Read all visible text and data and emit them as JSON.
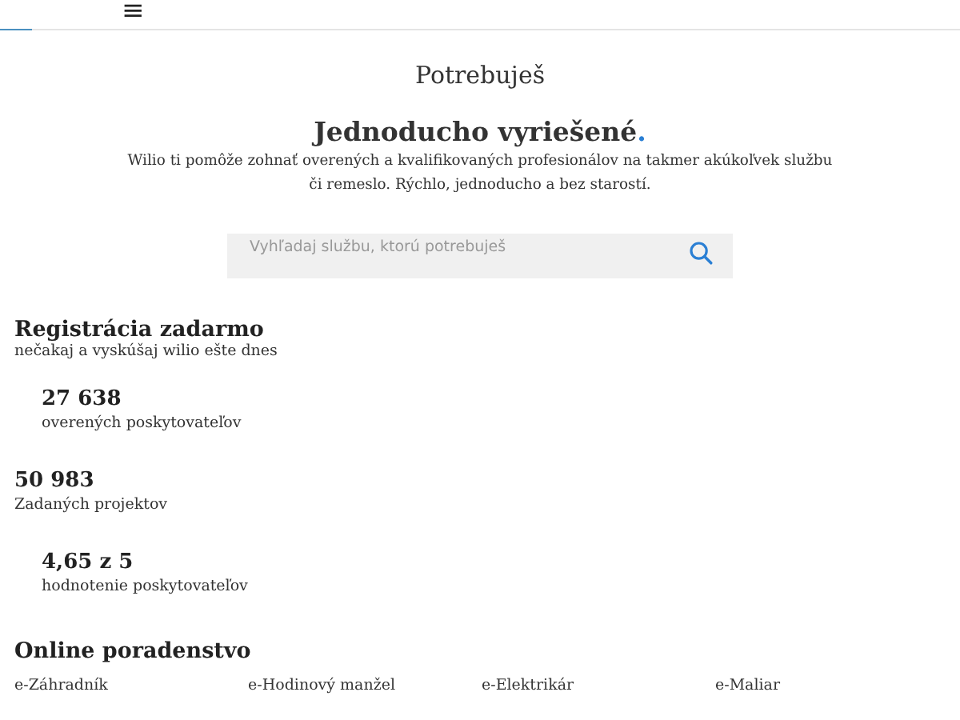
{
  "header": {
    "menu": "≡"
  },
  "hero": {
    "kicker": "Potrebuješ",
    "title": "Jednoducho vyriešené",
    "title_accent": ".",
    "text": "Wilio ti pomôže zohnať overených a kvalifikovaných profesionálov na takmer akúkoľvek službu či remeslo. Rýchlo, jednoducho a bez starostí."
  },
  "search": {
    "placeholder": "Vyhľadaj službu, ktorú potrebuješ"
  },
  "registration": {
    "title": "Registrácia zadarmo",
    "subtitle": "nečakaj a vyskúšaj wilio ešte dnes"
  },
  "stats": [
    {
      "kind": "indented",
      "value": "27 638",
      "label": "overených poskytovateľov"
    },
    {
      "kind": "plain",
      "value": "50 983",
      "label": "Zadaných projektov"
    },
    {
      "kind": "indented",
      "value": "4,65 z 5",
      "label": "hodnotenie poskytovateľov"
    }
  ],
  "online": {
    "title": "Online poradenstvo",
    "links": [
      "e-Záhradník",
      "e-Hodinový manžel",
      "e-Elektrikár",
      "e-Maliar"
    ]
  }
}
